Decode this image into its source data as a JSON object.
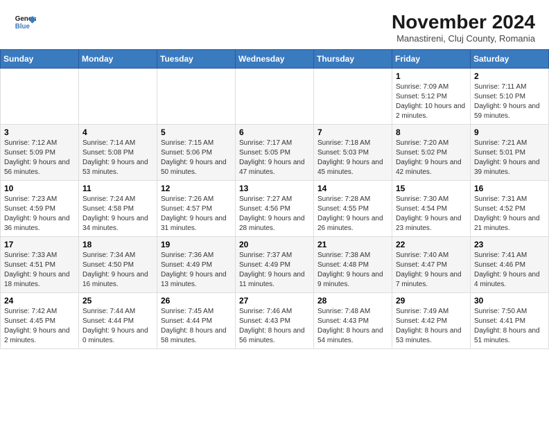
{
  "header": {
    "logo_line1": "General",
    "logo_line2": "Blue",
    "title": "November 2024",
    "subtitle": "Manastireni, Cluj County, Romania"
  },
  "weekdays": [
    "Sunday",
    "Monday",
    "Tuesday",
    "Wednesday",
    "Thursday",
    "Friday",
    "Saturday"
  ],
  "weeks": [
    [
      {
        "day": "",
        "info": ""
      },
      {
        "day": "",
        "info": ""
      },
      {
        "day": "",
        "info": ""
      },
      {
        "day": "",
        "info": ""
      },
      {
        "day": "",
        "info": ""
      },
      {
        "day": "1",
        "info": "Sunrise: 7:09 AM\nSunset: 5:12 PM\nDaylight: 10 hours and 2 minutes."
      },
      {
        "day": "2",
        "info": "Sunrise: 7:11 AM\nSunset: 5:10 PM\nDaylight: 9 hours and 59 minutes."
      }
    ],
    [
      {
        "day": "3",
        "info": "Sunrise: 7:12 AM\nSunset: 5:09 PM\nDaylight: 9 hours and 56 minutes."
      },
      {
        "day": "4",
        "info": "Sunrise: 7:14 AM\nSunset: 5:08 PM\nDaylight: 9 hours and 53 minutes."
      },
      {
        "day": "5",
        "info": "Sunrise: 7:15 AM\nSunset: 5:06 PM\nDaylight: 9 hours and 50 minutes."
      },
      {
        "day": "6",
        "info": "Sunrise: 7:17 AM\nSunset: 5:05 PM\nDaylight: 9 hours and 47 minutes."
      },
      {
        "day": "7",
        "info": "Sunrise: 7:18 AM\nSunset: 5:03 PM\nDaylight: 9 hours and 45 minutes."
      },
      {
        "day": "8",
        "info": "Sunrise: 7:20 AM\nSunset: 5:02 PM\nDaylight: 9 hours and 42 minutes."
      },
      {
        "day": "9",
        "info": "Sunrise: 7:21 AM\nSunset: 5:01 PM\nDaylight: 9 hours and 39 minutes."
      }
    ],
    [
      {
        "day": "10",
        "info": "Sunrise: 7:23 AM\nSunset: 4:59 PM\nDaylight: 9 hours and 36 minutes."
      },
      {
        "day": "11",
        "info": "Sunrise: 7:24 AM\nSunset: 4:58 PM\nDaylight: 9 hours and 34 minutes."
      },
      {
        "day": "12",
        "info": "Sunrise: 7:26 AM\nSunset: 4:57 PM\nDaylight: 9 hours and 31 minutes."
      },
      {
        "day": "13",
        "info": "Sunrise: 7:27 AM\nSunset: 4:56 PM\nDaylight: 9 hours and 28 minutes."
      },
      {
        "day": "14",
        "info": "Sunrise: 7:28 AM\nSunset: 4:55 PM\nDaylight: 9 hours and 26 minutes."
      },
      {
        "day": "15",
        "info": "Sunrise: 7:30 AM\nSunset: 4:54 PM\nDaylight: 9 hours and 23 minutes."
      },
      {
        "day": "16",
        "info": "Sunrise: 7:31 AM\nSunset: 4:52 PM\nDaylight: 9 hours and 21 minutes."
      }
    ],
    [
      {
        "day": "17",
        "info": "Sunrise: 7:33 AM\nSunset: 4:51 PM\nDaylight: 9 hours and 18 minutes."
      },
      {
        "day": "18",
        "info": "Sunrise: 7:34 AM\nSunset: 4:50 PM\nDaylight: 9 hours and 16 minutes."
      },
      {
        "day": "19",
        "info": "Sunrise: 7:36 AM\nSunset: 4:49 PM\nDaylight: 9 hours and 13 minutes."
      },
      {
        "day": "20",
        "info": "Sunrise: 7:37 AM\nSunset: 4:49 PM\nDaylight: 9 hours and 11 minutes."
      },
      {
        "day": "21",
        "info": "Sunrise: 7:38 AM\nSunset: 4:48 PM\nDaylight: 9 hours and 9 minutes."
      },
      {
        "day": "22",
        "info": "Sunrise: 7:40 AM\nSunset: 4:47 PM\nDaylight: 9 hours and 7 minutes."
      },
      {
        "day": "23",
        "info": "Sunrise: 7:41 AM\nSunset: 4:46 PM\nDaylight: 9 hours and 4 minutes."
      }
    ],
    [
      {
        "day": "24",
        "info": "Sunrise: 7:42 AM\nSunset: 4:45 PM\nDaylight: 9 hours and 2 minutes."
      },
      {
        "day": "25",
        "info": "Sunrise: 7:44 AM\nSunset: 4:44 PM\nDaylight: 9 hours and 0 minutes."
      },
      {
        "day": "26",
        "info": "Sunrise: 7:45 AM\nSunset: 4:44 PM\nDaylight: 8 hours and 58 minutes."
      },
      {
        "day": "27",
        "info": "Sunrise: 7:46 AM\nSunset: 4:43 PM\nDaylight: 8 hours and 56 minutes."
      },
      {
        "day": "28",
        "info": "Sunrise: 7:48 AM\nSunset: 4:43 PM\nDaylight: 8 hours and 54 minutes."
      },
      {
        "day": "29",
        "info": "Sunrise: 7:49 AM\nSunset: 4:42 PM\nDaylight: 8 hours and 53 minutes."
      },
      {
        "day": "30",
        "info": "Sunrise: 7:50 AM\nSunset: 4:41 PM\nDaylight: 8 hours and 51 minutes."
      }
    ]
  ]
}
